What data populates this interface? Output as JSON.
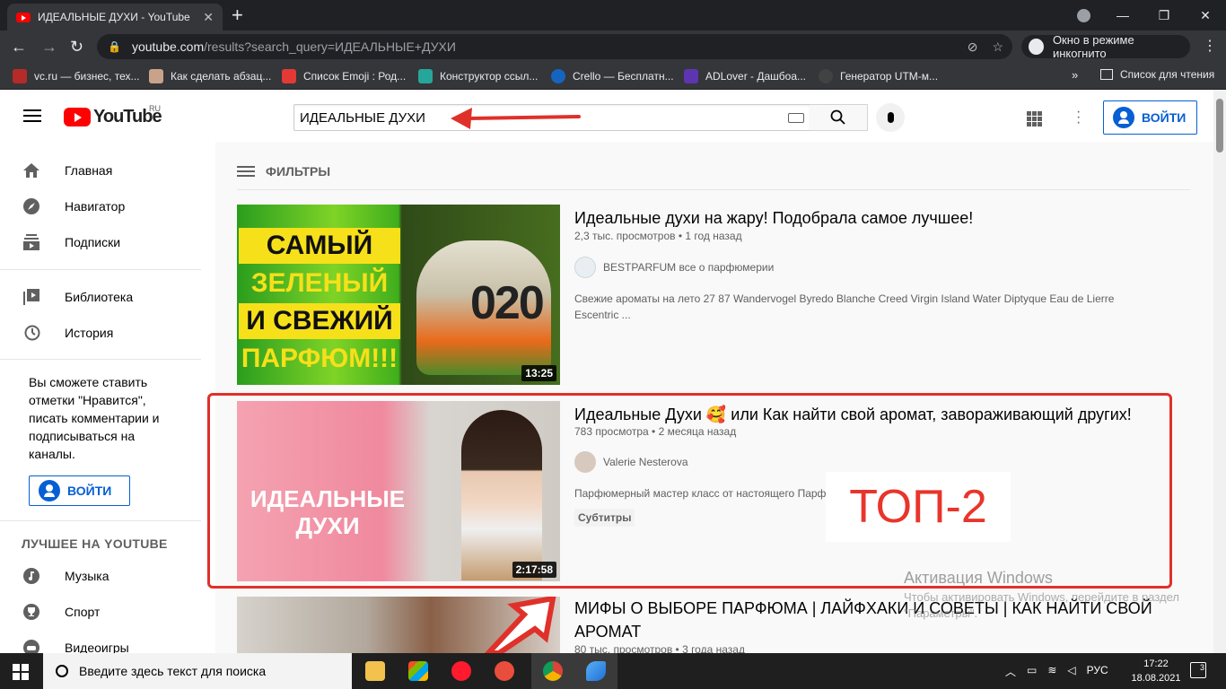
{
  "browser": {
    "tab_title": "ИДЕАЛЬНЫЕ ДУХИ - YouTube",
    "url_host": "youtube.com",
    "url_path": "/results?search_query=ИДЕАЛЬНЫЕ+ДУХИ",
    "incognito_label": "Окно в режиме инкогнито",
    "bookmarks": [
      {
        "label": "vc.ru — бизнес, тех...",
        "color": "#b52b27"
      },
      {
        "label": "Как сделать абзац...",
        "color": "#c9a28b"
      },
      {
        "label": "Список Emoji : Род...",
        "color": "#e53935"
      },
      {
        "label": "Конструктор ссыл...",
        "color": "#26a69a"
      },
      {
        "label": "Crello — Бесплатн...",
        "color": "#1565c0"
      },
      {
        "label": "ADLover - Дашбоа...",
        "color": "#5e35b1"
      },
      {
        "label": "Генератор UTM-м...",
        "color": "#424242"
      }
    ],
    "reading_list": "Список для чтения"
  },
  "header": {
    "logo_text": "YouTube",
    "logo_region": "RU",
    "search_value": "ИДЕАЛЬНЫЕ ДУХИ",
    "signin_label": "ВОЙТИ"
  },
  "sidebar": {
    "items": [
      {
        "label": "Главная",
        "icon": "home-icon"
      },
      {
        "label": "Навигатор",
        "icon": "compass-icon"
      },
      {
        "label": "Подписки",
        "icon": "subscriptions-icon"
      },
      {
        "label": "Библиотека",
        "icon": "library-icon"
      },
      {
        "label": "История",
        "icon": "history-icon"
      }
    ],
    "note": "Вы сможете ставить отметки \"Нравится\", писать комментарии и подписываться на каналы.",
    "signin_label": "ВОЙТИ",
    "section_title": "ЛУЧШЕЕ НА YOUTUBE",
    "best": [
      {
        "label": "Музыка",
        "icon": "music-icon"
      },
      {
        "label": "Спорт",
        "icon": "trophy-icon"
      },
      {
        "label": "Видеоигры",
        "icon": "gamepad-icon"
      }
    ]
  },
  "results": {
    "filters_label": "ФИЛЬТРЫ",
    "videos": [
      {
        "title": "Идеальные духи на жару! Подобрала самое лучшее!",
        "meta": "2,3 тыс. просмотров • 1 год назад",
        "channel": "BESTPARFUM все о парфюмерии",
        "description": "Свежие ароматы на лето 27 87 Wandervogel Byredo Blanche Creed Virgin Island Water Diptyque Eau de Lierre Escentric ...",
        "duration": "13:25",
        "thumb_lines": [
          "САМЫЙ",
          "ЗЕЛЕНЫЙ",
          "И СВЕЖИЙ",
          "ПАРФЮМ!!!"
        ],
        "thumb_bottle_text": "020"
      },
      {
        "title": "Идеальные Духи 🥰 или Как найти свой аромат, завораживающий других!",
        "meta": "783 просмотра • 2 месяца назад",
        "channel": "Valerie Nesterova",
        "description": "Парфюмерный мастер класс от настоящего Парфюмера. Как найти свой аромат, ...",
        "badge": "Субтитры",
        "duration": "2:17:58",
        "thumb_lines": [
          "ИДЕАЛЬНЫЕ",
          "ДУХИ"
        ]
      },
      {
        "title": "МИФЫ О ВЫБОРЕ ПАРФЮМА | ЛАЙФХАКИ И СОВЕТЫ | КАК НАЙТИ СВОЙ АРОМАТ",
        "meta": "80 тыс. просмотров • 3 года назад"
      }
    ]
  },
  "annotation": {
    "label": "ТОП-2"
  },
  "windows": {
    "watermark_title": "Активация Windows",
    "watermark_text": "Чтобы активировать Windows, перейдите в раздел \"Параметры\".",
    "search_placeholder": "Введите здесь текст для поиска",
    "lang": "РУС",
    "time": "17:22",
    "date": "18.08.2021",
    "notifications": "3"
  }
}
